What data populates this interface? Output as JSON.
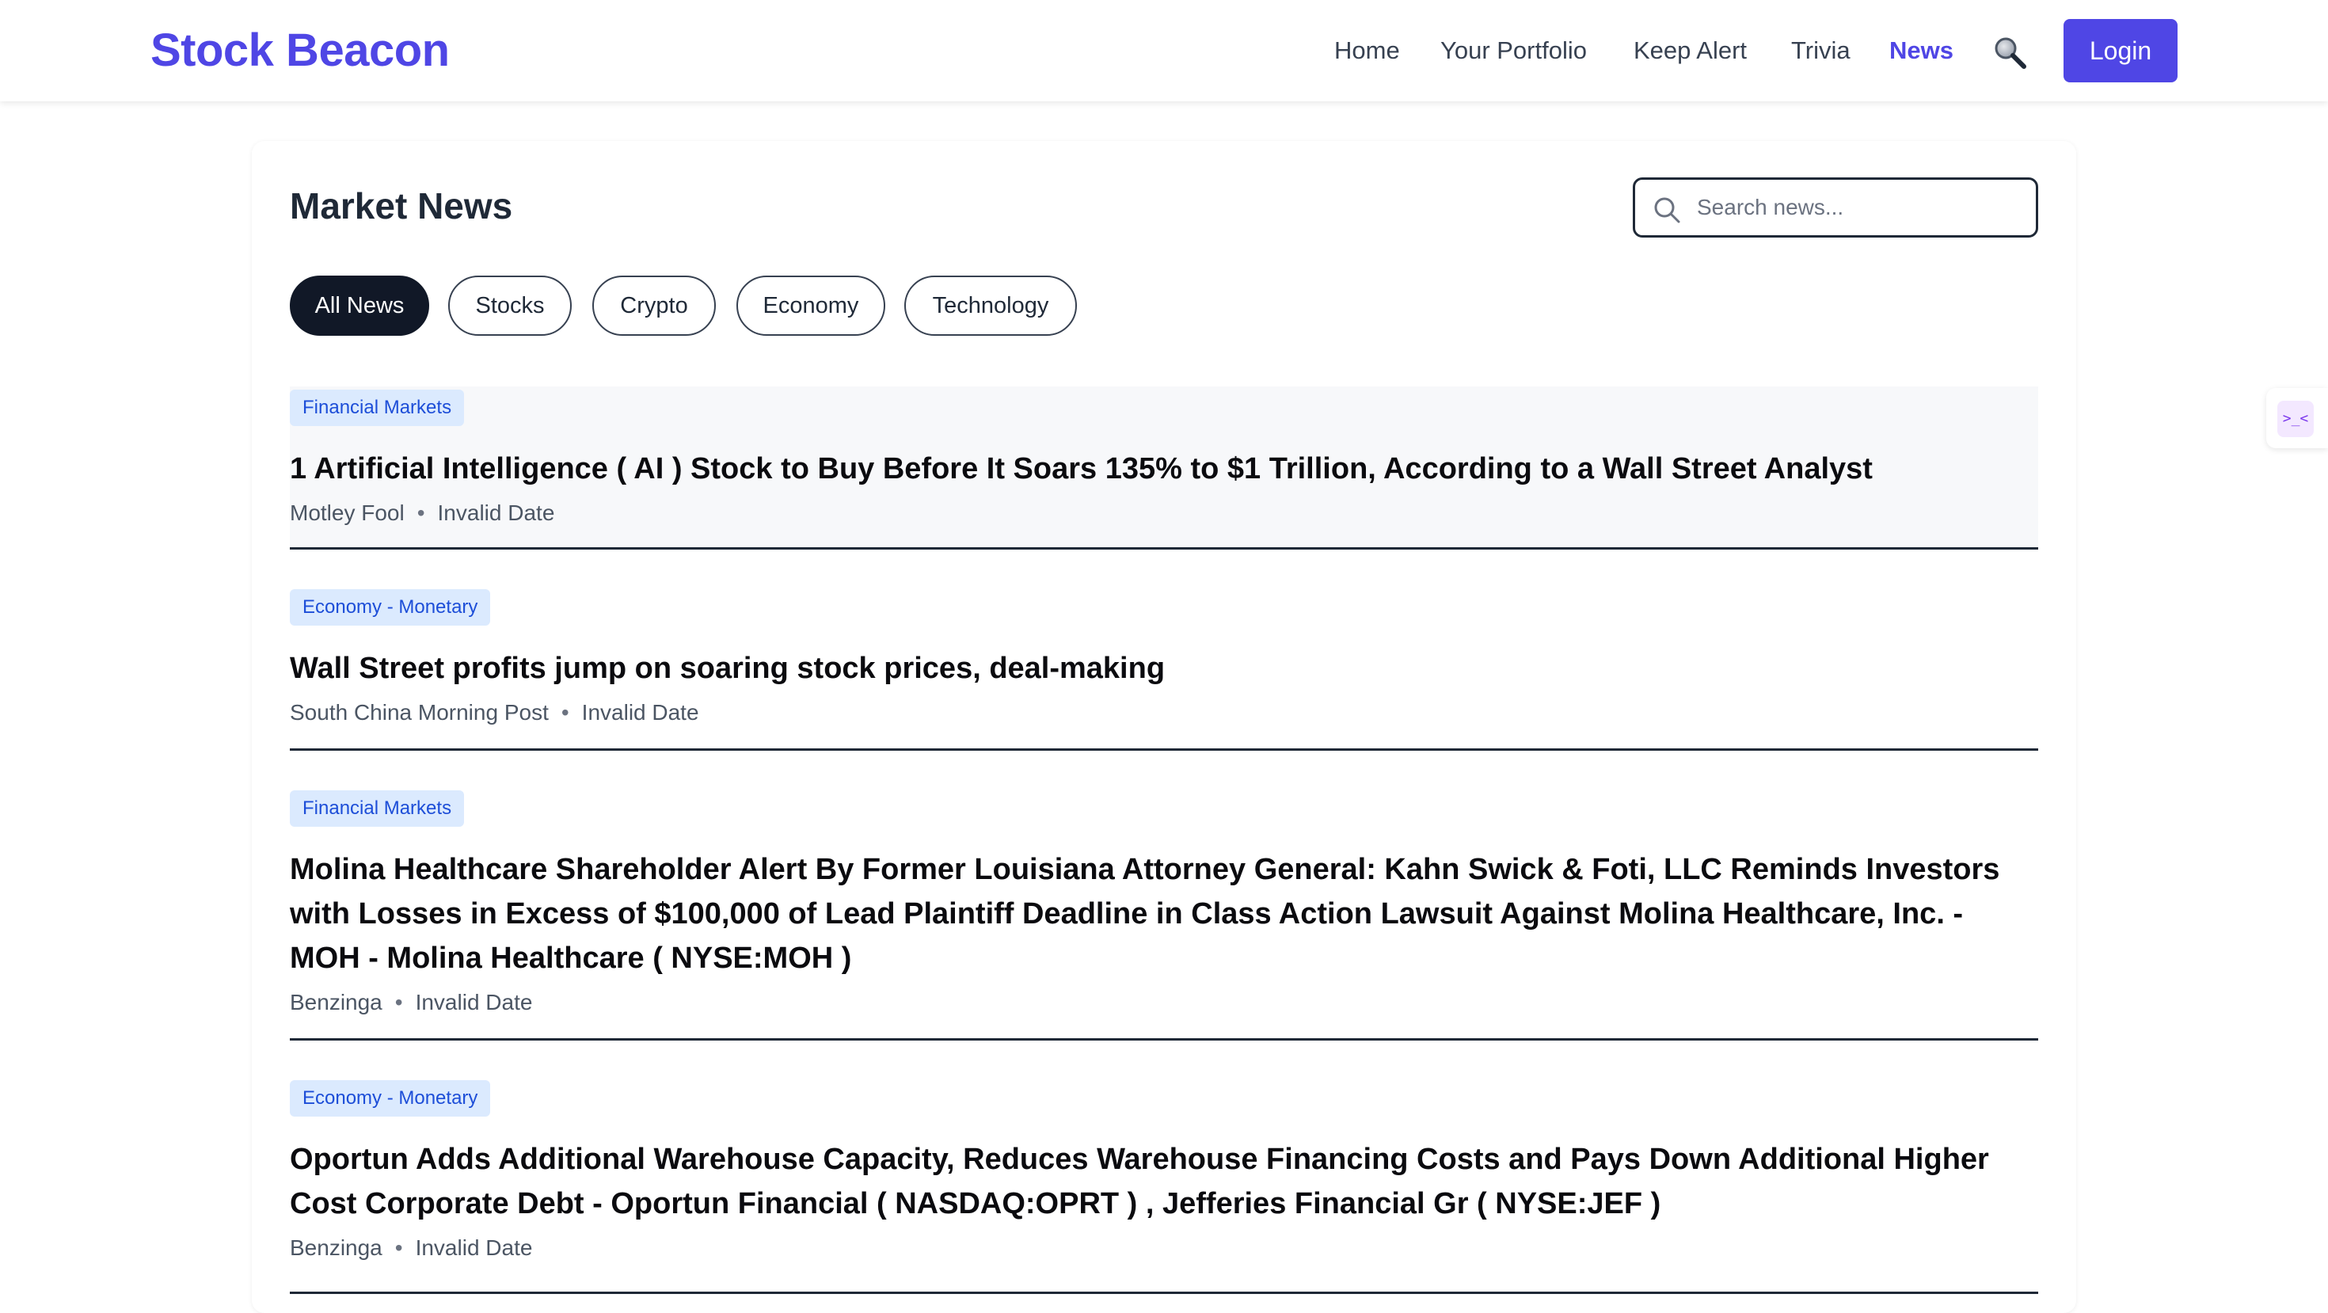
{
  "header": {
    "brand": "Stock Beacon",
    "nav": [
      {
        "label": "Home",
        "active": false
      },
      {
        "label": "Your Portfolio",
        "active": false
      },
      {
        "label": "Keep Alert",
        "active": false
      },
      {
        "label": "Trivia",
        "active": false
      },
      {
        "label": "News",
        "active": true
      }
    ],
    "search_icon": "search-icon",
    "login_label": "Login"
  },
  "main": {
    "title": "Market News",
    "search": {
      "placeholder": "Search news...",
      "value": ""
    },
    "filters": [
      {
        "label": "All News",
        "active": true
      },
      {
        "label": "Stocks",
        "active": false
      },
      {
        "label": "Crypto",
        "active": false
      },
      {
        "label": "Economy",
        "active": false
      },
      {
        "label": "Technology",
        "active": false
      }
    ],
    "articles": [
      {
        "tag": "Financial Markets",
        "headline": "1 Artificial Intelligence ( AI ) Stock to Buy Before It Soars 135% to $1 Trillion, According to a Wall Street Analyst",
        "source": "Motley Fool",
        "date": "Invalid Date"
      },
      {
        "tag": "Economy - Monetary",
        "headline": "Wall Street profits jump on soaring stock prices, deal-making",
        "source": "South China Morning Post",
        "date": "Invalid Date"
      },
      {
        "tag": "Financial Markets",
        "headline": "Molina Healthcare Shareholder Alert By Former Louisiana Attorney General: Kahn Swick & Foti, LLC Reminds Investors with Losses in Excess of $100,000 of Lead Plaintiff Deadline in Class Action Lawsuit Against Molina Healthcare, Inc. - MOH - Molina Healthcare ( NYSE:MOH )",
        "source": "Benzinga",
        "date": "Invalid Date"
      },
      {
        "tag": "Economy - Monetary",
        "headline": "Oportun Adds Additional Warehouse Capacity, Reduces Warehouse Financing Costs and Pays Down Additional Higher Cost Corporate Debt - Oportun Financial ( NASDAQ:OPRT ) , Jefferies Financial Gr ( NYSE:JEF )",
        "source": "Benzinga",
        "date": "Invalid Date"
      }
    ],
    "meta_separator": "•"
  },
  "side_widget": {
    "glyph": ">_<"
  },
  "colors": {
    "brand": "#4f46e5",
    "tag_bg": "#dbeafe",
    "tag_text": "#1d4ed8",
    "chip_active": "#111827"
  }
}
